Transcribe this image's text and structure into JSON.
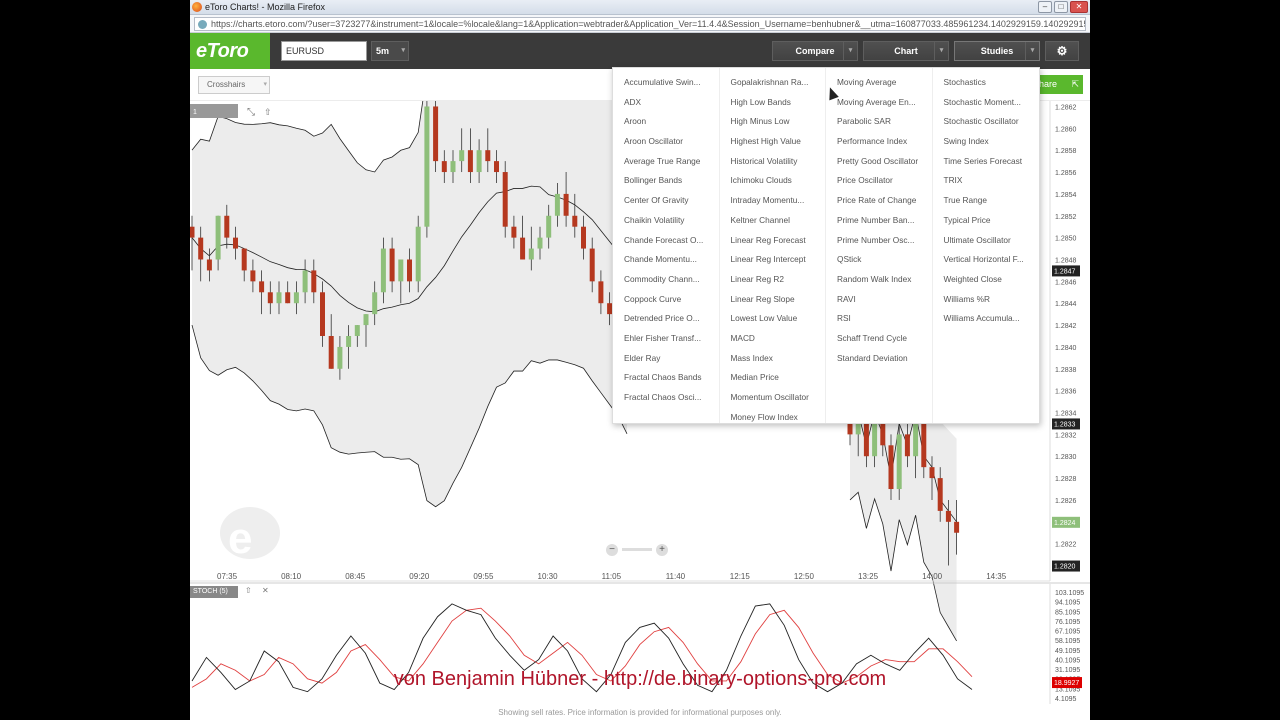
{
  "browser": {
    "title": "eToro Charts! - Mozilla Firefox",
    "url": "https://charts.etoro.com/?user=3723277&instrument=1&locale=%locale&lang=1&Application=webtrader&Application_Ver=11.4.4&Session_Username=benhubner&__utma=160877033.485961234.1402929159.1402929159.1411558712.28/"
  },
  "toolbar": {
    "logo": "eToro",
    "instrument": "EURUSD",
    "timeframe": "5m",
    "compare_label": "Compare",
    "chart_label": "Chart",
    "studies_label": "Studies",
    "crosshairs_label": "Crosshairs",
    "share_label": "hare"
  },
  "studies_menu": {
    "columns": [
      [
        "Accumulative Swin...",
        "ADX",
        "Aroon",
        "Aroon Oscillator",
        "Average True Range",
        "Bollinger Bands",
        "Center Of Gravity",
        "Chaikin Volatility",
        "Chande Forecast O...",
        "Chande Momentu...",
        "Commodity Chann...",
        "Coppock Curve",
        "Detrended Price O...",
        "Ehler Fisher Transf...",
        "Elder Ray",
        "Fractal Chaos Bands",
        "Fractal Chaos Osci..."
      ],
      [
        "Gopalakrishnan Ra...",
        "High Low Bands",
        "High Minus Low",
        "Highest High Value",
        "Historical Volatility",
        "Ichimoku Clouds",
        "Intraday Momentu...",
        "Keltner Channel",
        "Linear Reg Forecast",
        "Linear Reg Intercept",
        "Linear Reg R2",
        "Linear Reg Slope",
        "Lowest Low Value",
        "MACD",
        "Mass Index",
        "Median Price",
        "Momentum Oscillator",
        "Money Flow Index"
      ],
      [
        "Moving Average",
        "Moving Average En...",
        "Parabolic SAR",
        "Performance Index",
        "Pretty Good Oscillator",
        "Price Oscillator",
        "Price Rate of Change",
        "Prime Number Ban...",
        "Prime Number Osc...",
        "QStick",
        "Random Walk Index",
        "RAVI",
        "RSI",
        "Schaff Trend Cycle",
        "Standard Deviation"
      ],
      [
        "Stochastics",
        "Stochastic Moment...",
        "Stochastic Oscillator",
        "Swing Index",
        "Time Series Forecast",
        "TRIX",
        "True Range",
        "Typical Price",
        "Ultimate Oscillator",
        "Vertical Horizontal F...",
        "Weighted Close",
        "Williams %R",
        "Williams Accumula..."
      ]
    ]
  },
  "price_axis": {
    "ticks": [
      "1.2862",
      "1.2860",
      "1.2858",
      "1.2856",
      "1.2854",
      "1.2852",
      "1.2850",
      "1.2848",
      "1.2846",
      "1.2844",
      "1.2842",
      "1.2840",
      "1.2838",
      "1.2836",
      "1.2834",
      "1.2832",
      "1.2830",
      "1.2828",
      "1.2826",
      "1.2824",
      "1.2822",
      "1.2820"
    ],
    "current_price": "1.2847",
    "mid_marker": "1.2833",
    "green_marker": "1.2824",
    "low_marker": "1.2820"
  },
  "time_axis": {
    "ticks": [
      "07:35",
      "08:10",
      "08:45",
      "09:20",
      "09:55",
      "10:30",
      "11:05",
      "11:40",
      "12:15",
      "12:50",
      "13:25",
      "14:00",
      "14:35"
    ]
  },
  "chart_tab": "1",
  "stoch": {
    "label": "STOCH (5)",
    "ticks": [
      "103.1095",
      "94.1095",
      "85.1095",
      "76.1095",
      "67.1095",
      "58.1095",
      "49.1095",
      "40.1095",
      "31.1095",
      "22.1095",
      "13.1095",
      "4.1095"
    ],
    "current_value": "18.9927"
  },
  "footer": "Showing sell rates. Price information is provided for informational purposes only.",
  "watermark": "von Benjamin Hübner - http://de.binary-options-pro.com",
  "colors": {
    "bull": "#8ebf7a",
    "bear": "#b5381f",
    "brand": "#5ab82d",
    "stoch_k": "#222222",
    "stoch_d": "#e04040"
  },
  "chart_data": {
    "type": "candlestick",
    "candles": [
      {
        "o": 1.2851,
        "h": 1.2852,
        "l": 1.2847,
        "c": 1.285
      },
      {
        "o": 1.285,
        "h": 1.2851,
        "l": 1.2846,
        "c": 1.2848
      },
      {
        "o": 1.2848,
        "h": 1.2849,
        "l": 1.2846,
        "c": 1.2847
      },
      {
        "o": 1.2848,
        "h": 1.2852,
        "l": 1.2847,
        "c": 1.2852
      },
      {
        "o": 1.2852,
        "h": 1.2853,
        "l": 1.2849,
        "c": 1.285
      },
      {
        "o": 1.285,
        "h": 1.2851,
        "l": 1.2848,
        "c": 1.2849
      },
      {
        "o": 1.2849,
        "h": 1.2849,
        "l": 1.2846,
        "c": 1.2847
      },
      {
        "o": 1.2847,
        "h": 1.2848,
        "l": 1.2845,
        "c": 1.2846
      },
      {
        "o": 1.2846,
        "h": 1.2847,
        "l": 1.2843,
        "c": 1.2845
      },
      {
        "o": 1.2845,
        "h": 1.2846,
        "l": 1.2843,
        "c": 1.2844
      },
      {
        "o": 1.2844,
        "h": 1.2846,
        "l": 1.2843,
        "c": 1.2845
      },
      {
        "o": 1.2845,
        "h": 1.2846,
        "l": 1.2844,
        "c": 1.2844
      },
      {
        "o": 1.2844,
        "h": 1.2846,
        "l": 1.2843,
        "c": 1.2845
      },
      {
        "o": 1.2845,
        "h": 1.2848,
        "l": 1.2844,
        "c": 1.2847
      },
      {
        "o": 1.2847,
        "h": 1.2848,
        "l": 1.2844,
        "c": 1.2845
      },
      {
        "o": 1.2845,
        "h": 1.2846,
        "l": 1.284,
        "c": 1.2841
      },
      {
        "o": 1.2841,
        "h": 1.2843,
        "l": 1.2838,
        "c": 1.2838
      },
      {
        "o": 1.2838,
        "h": 1.2841,
        "l": 1.2837,
        "c": 1.284
      },
      {
        "o": 1.284,
        "h": 1.2842,
        "l": 1.2838,
        "c": 1.2841
      },
      {
        "o": 1.2841,
        "h": 1.2842,
        "l": 1.284,
        "c": 1.2842
      },
      {
        "o": 1.2842,
        "h": 1.2843,
        "l": 1.284,
        "c": 1.2843
      },
      {
        "o": 1.2843,
        "h": 1.2846,
        "l": 1.2842,
        "c": 1.2845
      },
      {
        "o": 1.2845,
        "h": 1.285,
        "l": 1.2844,
        "c": 1.2849
      },
      {
        "o": 1.2849,
        "h": 1.285,
        "l": 1.2845,
        "c": 1.2846
      },
      {
        "o": 1.2846,
        "h": 1.2848,
        "l": 1.2844,
        "c": 1.2848
      },
      {
        "o": 1.2848,
        "h": 1.2849,
        "l": 1.2845,
        "c": 1.2846
      },
      {
        "o": 1.2846,
        "h": 1.2852,
        "l": 1.2845,
        "c": 1.2851
      },
      {
        "o": 1.2851,
        "h": 1.2863,
        "l": 1.285,
        "c": 1.2862
      },
      {
        "o": 1.2862,
        "h": 1.2863,
        "l": 1.2856,
        "c": 1.2857
      },
      {
        "o": 1.2857,
        "h": 1.2858,
        "l": 1.2855,
        "c": 1.2856
      },
      {
        "o": 1.2856,
        "h": 1.2858,
        "l": 1.2855,
        "c": 1.2857
      },
      {
        "o": 1.2857,
        "h": 1.286,
        "l": 1.2856,
        "c": 1.2858
      },
      {
        "o": 1.2858,
        "h": 1.286,
        "l": 1.2855,
        "c": 1.2856
      },
      {
        "o": 1.2856,
        "h": 1.2859,
        "l": 1.2855,
        "c": 1.2858
      },
      {
        "o": 1.2858,
        "h": 1.286,
        "l": 1.2856,
        "c": 1.2857
      },
      {
        "o": 1.2857,
        "h": 1.2858,
        "l": 1.2855,
        "c": 1.2856
      },
      {
        "o": 1.2856,
        "h": 1.2857,
        "l": 1.285,
        "c": 1.2851
      },
      {
        "o": 1.2851,
        "h": 1.2852,
        "l": 1.2849,
        "c": 1.285
      },
      {
        "o": 1.285,
        "h": 1.2852,
        "l": 1.2848,
        "c": 1.2848
      },
      {
        "o": 1.2848,
        "h": 1.2851,
        "l": 1.2847,
        "c": 1.2849
      },
      {
        "o": 1.2849,
        "h": 1.2851,
        "l": 1.2848,
        "c": 1.285
      },
      {
        "o": 1.285,
        "h": 1.2853,
        "l": 1.2849,
        "c": 1.2852
      },
      {
        "o": 1.2852,
        "h": 1.2855,
        "l": 1.2851,
        "c": 1.2854
      },
      {
        "o": 1.2854,
        "h": 1.2856,
        "l": 1.2851,
        "c": 1.2852
      },
      {
        "o": 1.2852,
        "h": 1.2854,
        "l": 1.285,
        "c": 1.2851
      },
      {
        "o": 1.2851,
        "h": 1.2852,
        "l": 1.2848,
        "c": 1.2849
      },
      {
        "o": 1.2849,
        "h": 1.285,
        "l": 1.2845,
        "c": 1.2846
      },
      {
        "o": 1.2846,
        "h": 1.2847,
        "l": 1.2843,
        "c": 1.2844
      },
      {
        "o": 1.2844,
        "h": 1.2845,
        "l": 1.2842,
        "c": 1.2843
      },
      {
        "o": 1.2843,
        "h": 1.2844,
        "l": 1.2841,
        "c": 1.2842
      },
      {
        "o": 1.2842,
        "h": 1.2843,
        "l": 1.284,
        "c": 1.2841
      }
    ],
    "late_candles": [
      {
        "o": 1.2834,
        "h": 1.2835,
        "l": 1.2831,
        "c": 1.2832
      },
      {
        "o": 1.2832,
        "h": 1.2834,
        "l": 1.283,
        "c": 1.2833
      },
      {
        "o": 1.2833,
        "h": 1.2834,
        "l": 1.2829,
        "c": 1.283
      },
      {
        "o": 1.283,
        "h": 1.2834,
        "l": 1.2829,
        "c": 1.2833
      },
      {
        "o": 1.2833,
        "h": 1.2834,
        "l": 1.283,
        "c": 1.2831
      },
      {
        "o": 1.2831,
        "h": 1.2832,
        "l": 1.2826,
        "c": 1.2827
      },
      {
        "o": 1.2827,
        "h": 1.2833,
        "l": 1.2826,
        "c": 1.2832
      },
      {
        "o": 1.2832,
        "h": 1.2834,
        "l": 1.2829,
        "c": 1.283
      },
      {
        "o": 1.283,
        "h": 1.2834,
        "l": 1.2828,
        "c": 1.2833
      },
      {
        "o": 1.2833,
        "h": 1.2834,
        "l": 1.2828,
        "c": 1.2829
      },
      {
        "o": 1.2829,
        "h": 1.283,
        "l": 1.2826,
        "c": 1.2828
      },
      {
        "o": 1.2828,
        "h": 1.2829,
        "l": 1.2824,
        "c": 1.2825
      },
      {
        "o": 1.2825,
        "h": 1.2826,
        "l": 1.282,
        "c": 1.2824
      },
      {
        "o": 1.2824,
        "h": 1.2826,
        "l": 1.2821,
        "c": 1.2823
      }
    ],
    "stoch_k": [
      20,
      42,
      28,
      12,
      20,
      48,
      38,
      14,
      10,
      22,
      44,
      62,
      46,
      18,
      12,
      28,
      60,
      80,
      92,
      86,
      82,
      60,
      44,
      30,
      40,
      62,
      48,
      22,
      10,
      26,
      56,
      70,
      74,
      60,
      36,
      16,
      10,
      30,
      62,
      90,
      92,
      72,
      40,
      18,
      10,
      18,
      36,
      44,
      36,
      30,
      46,
      60,
      44,
      22,
      12
    ],
    "stoch_d": [
      14,
      22,
      36,
      30,
      20,
      26,
      42,
      36,
      22,
      18,
      28,
      48,
      54,
      40,
      24,
      20,
      36,
      56,
      76,
      86,
      88,
      76,
      62,
      44,
      36,
      46,
      56,
      44,
      26,
      20,
      34,
      54,
      66,
      70,
      56,
      36,
      20,
      20,
      38,
      64,
      82,
      86,
      70,
      46,
      26,
      18,
      24,
      34,
      40,
      38,
      38,
      50,
      50,
      38,
      24
    ]
  }
}
